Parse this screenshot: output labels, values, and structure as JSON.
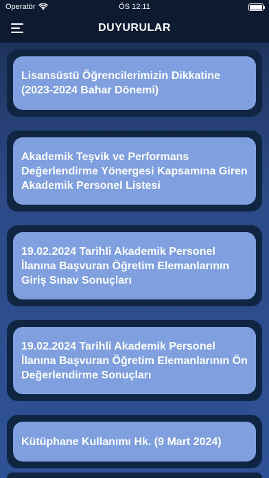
{
  "status_bar": {
    "carrier": "Operatör",
    "time": "ÖS 12:11"
  },
  "header": {
    "title": "DUYURULAR",
    "menu_icon": "hamburger-menu-icon"
  },
  "announcements": [
    {
      "title": "Lisansüstü Öğrencilerimizin Dikkatine (2023-2024 Bahar Dönemi)"
    },
    {
      "title": "Akademik Teşvik ve Performans Değerlendirme Yönergesi Kapsamına Giren Akademik Personel Listesi"
    },
    {
      "title": "19.02.2024 Tarihli Akademik Personel İlanına Başvuran Öğretim Elemanlarının Giriş Sınav Sonuçları"
    },
    {
      "title": "19.02.2024 Tarihli Akademik Personel İlanına Başvuran Öğretim Elemanlarının Ön Değerlendirme Sonuçları"
    },
    {
      "title": "Kütüphane Kullanımı Hk. (9 Mart 2024)"
    }
  ],
  "colors": {
    "background_top": "#1a2d50",
    "background_bottom": "#2f5197",
    "card_outer": "#0f2542",
    "card_inner": "#7f9fdf",
    "text": "#ffffff"
  }
}
